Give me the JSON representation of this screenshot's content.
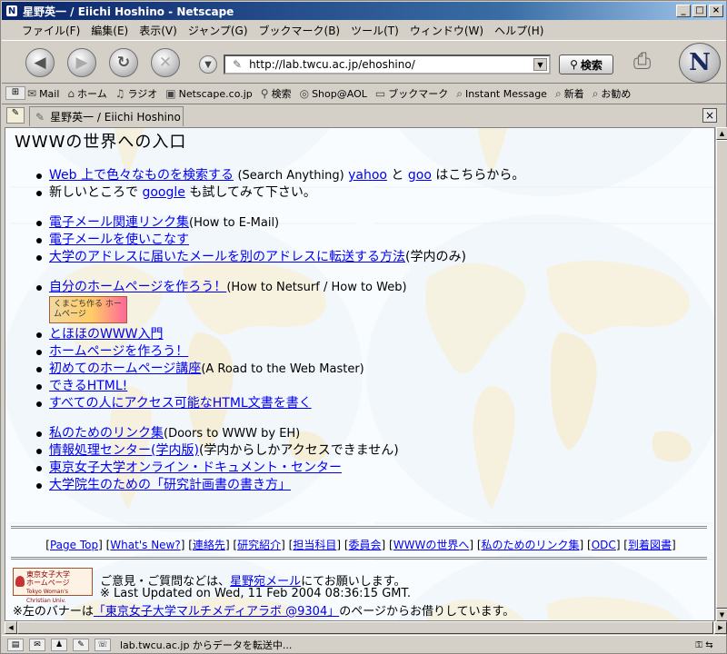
{
  "window": {
    "title": "星野英一 / Eiichi Hoshino - Netscape",
    "icon_letter": "N"
  },
  "menu": [
    "ファイル(F)",
    "編集(E)",
    "表示(V)",
    "ジャンプ(G)",
    "ブックマーク(B)",
    "ツール(T)",
    "ウィンドウ(W)",
    "ヘルプ(H)"
  ],
  "toolbar": {
    "url": "http://lab.twcu.ac.jp/ehoshino/",
    "search_label": "検索",
    "logo_letter": "N"
  },
  "personal_toolbar": [
    {
      "icon": "mail-icon",
      "glyph": "✉",
      "label": "Mail"
    },
    {
      "icon": "home-icon",
      "glyph": "⌂",
      "label": "ホーム"
    },
    {
      "icon": "radio-icon",
      "glyph": "♫",
      "label": "ラジオ"
    },
    {
      "icon": "my-icon",
      "glyph": "▣",
      "label": "Netscape.co.jp"
    },
    {
      "icon": "search-icon",
      "glyph": "⚲",
      "label": "検索"
    },
    {
      "icon": "shop-icon",
      "glyph": "◎",
      "label": "Shop@AOL"
    },
    {
      "icon": "folder-icon",
      "glyph": "▭",
      "label": "ブックマーク"
    },
    {
      "icon": "bookmark-icon",
      "glyph": "⌕",
      "label": "Instant Message"
    },
    {
      "icon": "bookmark-icon",
      "glyph": "⌕",
      "label": "新着"
    },
    {
      "icon": "bookmark-icon",
      "glyph": "⌕",
      "label": "お勧め"
    }
  ],
  "tab": {
    "label": "星野英一 / Eiichi Hoshino"
  },
  "page": {
    "heading": "WWWの世界への入口",
    "group1": [
      {
        "link": "Web 上で色々なものを検索する",
        "after": "(Search Anything)",
        "link2": "yahoo",
        "mid": "と",
        "link3": "goo",
        "tail": "はこちらから。"
      },
      {
        "pre": "新しいところで",
        "link": "google",
        "tail": "も試してみて下さい。"
      }
    ],
    "group2": [
      {
        "link": "電子メール関連リンク集",
        "tail": "(How to E-Mail)"
      },
      {
        "link": "電子メールを使いこなす",
        "tail": ""
      },
      {
        "link": "大学のアドレスに届いたメールを別のアドレスに転送する方法",
        "tail": "(学内のみ)"
      }
    ],
    "group3_first": {
      "link": "自分のホームページを作ろう！",
      "tail": "(How to Netsurf / How to Web)"
    },
    "banner": "くまごち作る ホームページ",
    "group3": [
      {
        "link": "とほほのWWW入門",
        "tail": ""
      },
      {
        "link": "ホームページを作ろう！",
        "tail": ""
      },
      {
        "link": "初めてのホームページ講座",
        "tail": "(A Road to the Web Master)"
      },
      {
        "link": "できるHTML!",
        "tail": ""
      },
      {
        "link": "すべての人にアクセス可能なHTML文書を書く",
        "tail": ""
      }
    ],
    "group4": [
      {
        "link": "私のためのリンク集",
        "tail": "(Doors to WWW by EH)"
      },
      {
        "link": "情報処理センター(学内版)",
        "tail": "(学内からしかアクセスできません)"
      },
      {
        "link": "東京女子大学オンライン・ドキュメント・センター",
        "tail": ""
      },
      {
        "link": "大学院生のための「研究計画書の書き方」",
        "tail": ""
      }
    ],
    "footer_nav": [
      "Page Top",
      "What's New?",
      "連絡先",
      "研究紹介",
      "担当科目",
      "委員会",
      "WWWの世界へ",
      "私のためのリンク集",
      "ODC",
      "到着図書"
    ],
    "twcu_banner": {
      "line1": "東京女子大学",
      "line2": "ホームページ",
      "line3": "Tokyo Woman's Christian Univ."
    },
    "contact_pre": "ご意見・ご質問などは、",
    "contact_link": "星野宛メール",
    "contact_post": "にてお願いします。",
    "updated": "※ Last Updated on Wed, 11 Feb 2004 08:36:15 GMT.",
    "credit_pre": "※左のバナーは",
    "credit_link": "「東京女子大学マルチメディアラボ @9304」",
    "credit_post": "のページからお借りしています。"
  },
  "status": {
    "text": "lab.twcu.ac.jp からデータを転送中..."
  }
}
